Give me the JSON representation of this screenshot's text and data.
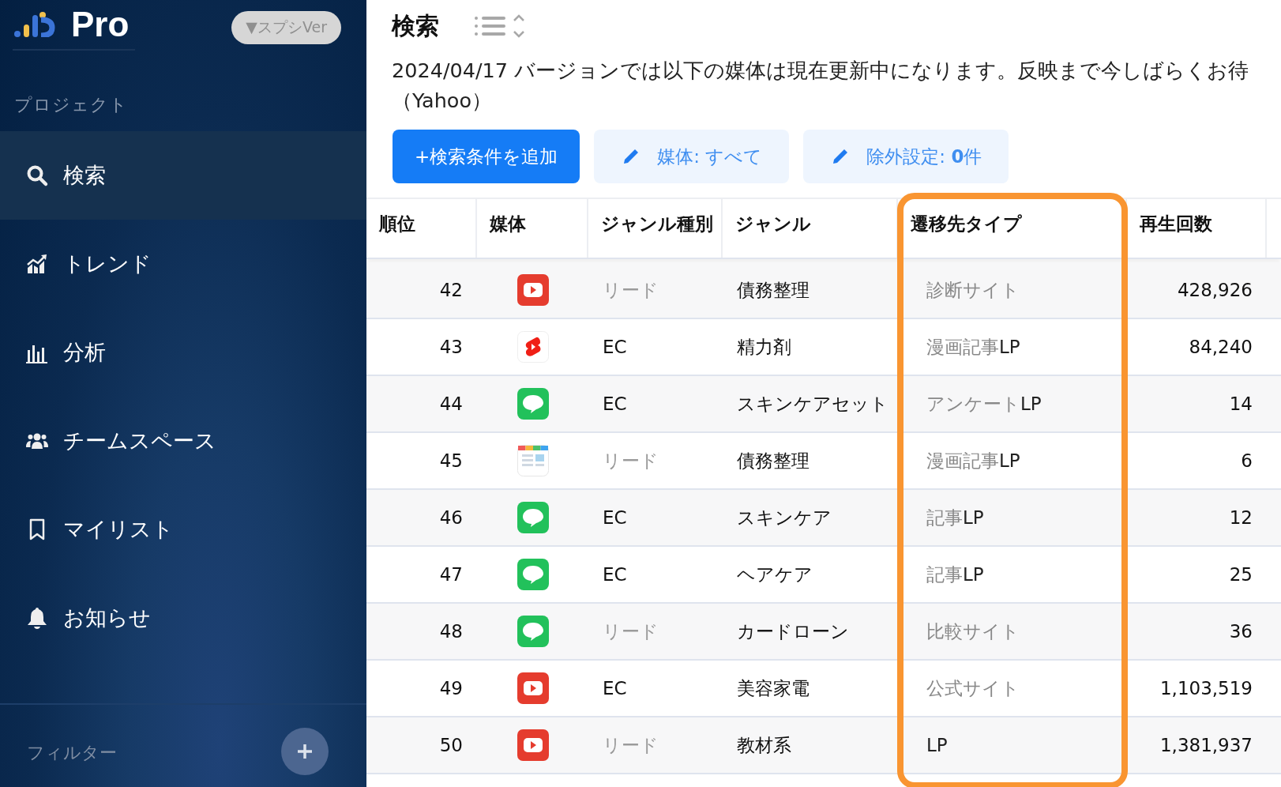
{
  "sidebar": {
    "logo_text": "Pro",
    "version_button": "▼スプシVer",
    "section_label": "プロジェクト",
    "items": [
      {
        "label": "検索",
        "kind": "search",
        "selected": true
      },
      {
        "label": "トレンド",
        "kind": "trend",
        "selected": false
      },
      {
        "label": "分析",
        "kind": "bars",
        "selected": false
      },
      {
        "label": "チームスペース",
        "kind": "team",
        "selected": false
      },
      {
        "label": "マイリスト",
        "kind": "bookmark",
        "selected": false
      },
      {
        "label": "お知らせ",
        "kind": "bell",
        "selected": false
      }
    ],
    "filter_label": "フィルター"
  },
  "header": {
    "title": "検索",
    "notice_lines": [
      "2024/04/17 バージョンでは以下の媒体は現在更新中になります。反映まで今しばらくお待",
      "（Yahoo）"
    ],
    "buttons": [
      {
        "label": "+検索条件を追加",
        "kind": "primary"
      },
      {
        "label": "媒体: すべて",
        "kind": "edit"
      },
      {
        "label": "除外設定: **0**件",
        "kind": "edit"
      }
    ]
  },
  "table": {
    "columns": [
      "順位",
      "媒体",
      "ジャンル種別",
      "ジャンル",
      "遷移先タイプ",
      "再生回数"
    ],
    "rows": [
      {
        "rank": "42",
        "kind": "youtube",
        "genre_type": "リード",
        "muted": true,
        "genre": "債務整理",
        "destination": "診断サイト",
        "plays": "428,926"
      },
      {
        "rank": "43",
        "kind": "shorts",
        "genre_type": "EC",
        "muted": false,
        "genre": "精力剤",
        "destination": "漫画記事**LP**",
        "plays": "84,240"
      },
      {
        "rank": "44",
        "kind": "line",
        "genre_type": "EC",
        "muted": false,
        "genre": "スキンケアセット",
        "destination": "アンケート**LP**",
        "plays": "14"
      },
      {
        "rank": "45",
        "kind": "news",
        "genre_type": "リード",
        "muted": true,
        "genre": "債務整理",
        "destination": "漫画記事**LP**",
        "plays": "6"
      },
      {
        "rank": "46",
        "kind": "line",
        "genre_type": "EC",
        "muted": false,
        "genre": "スキンケア",
        "destination": "記事**LP**",
        "plays": "12"
      },
      {
        "rank": "47",
        "kind": "line",
        "genre_type": "EC",
        "muted": false,
        "genre": "ヘアケア",
        "destination": "記事**LP**",
        "plays": "25"
      },
      {
        "rank": "48",
        "kind": "line",
        "genre_type": "リード",
        "muted": true,
        "genre": "カードローン",
        "destination": "比較サイト",
        "plays": "36"
      },
      {
        "rank": "49",
        "kind": "youtube",
        "genre_type": "EC",
        "muted": false,
        "genre": "美容家電",
        "destination": "公式サイト",
        "plays": "1,103,519"
      },
      {
        "rank": "50",
        "kind": "youtube",
        "genre_type": "リード",
        "muted": true,
        "genre": "教材系",
        "destination": "**LP**",
        "plays": "1,381,937"
      }
    ]
  }
}
